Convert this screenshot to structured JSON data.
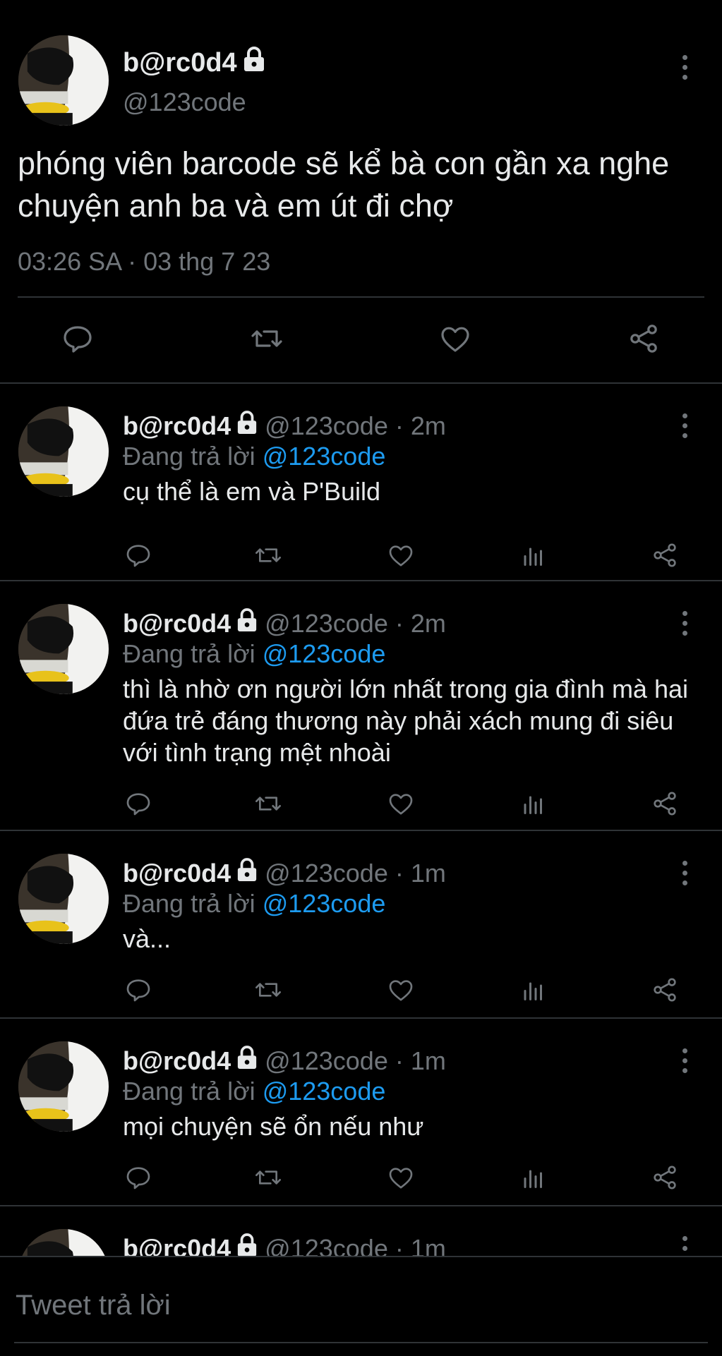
{
  "main_tweet": {
    "display_name": "b@rc0d4",
    "handle": "@123code",
    "text": "phóng viên barcode sẽ kể bà con gần xa nghe chuyện anh ba và em út đi chợ",
    "timestamp": "03:26 SA · 03 thg 7 23",
    "icons": [
      "reply-icon",
      "retweet-icon",
      "like-icon",
      "share-icon"
    ]
  },
  "replies": [
    {
      "display_name": "b@rc0d4",
      "meta": "@123code · 2m",
      "replying_prefix": "Đang trả lời ",
      "replying_to": "@123code",
      "text": "cụ thể là em và P'Build"
    },
    {
      "display_name": "b@rc0d4",
      "meta": "@123code · 2m",
      "replying_prefix": "Đang trả lời ",
      "replying_to": "@123code",
      "text": "thì là nhờ ơn người lớn nhất trong gia đình mà hai đứa trẻ đáng thương này phải xách mung đi siêu với tình trạng mệt nhoài"
    },
    {
      "display_name": "b@rc0d4",
      "meta": "@123code · 1m",
      "replying_prefix": "Đang trả lời ",
      "replying_to": "@123code",
      "text": "và..."
    },
    {
      "display_name": "b@rc0d4",
      "meta": "@123code · 1m",
      "replying_prefix": "Đang trả lời ",
      "replying_to": "@123code",
      "text": "mọi chuyện sẽ ổn nếu như"
    },
    {
      "display_name": "b@rc0d4",
      "meta": "@123code · 1m"
    }
  ],
  "composer": {
    "placeholder": "Tweet trả lời"
  },
  "colors": {
    "background": "#000000",
    "text": "#e7e9ea",
    "muted": "#71767b",
    "accent": "#1d9bf0",
    "divider": "#2f3336"
  }
}
